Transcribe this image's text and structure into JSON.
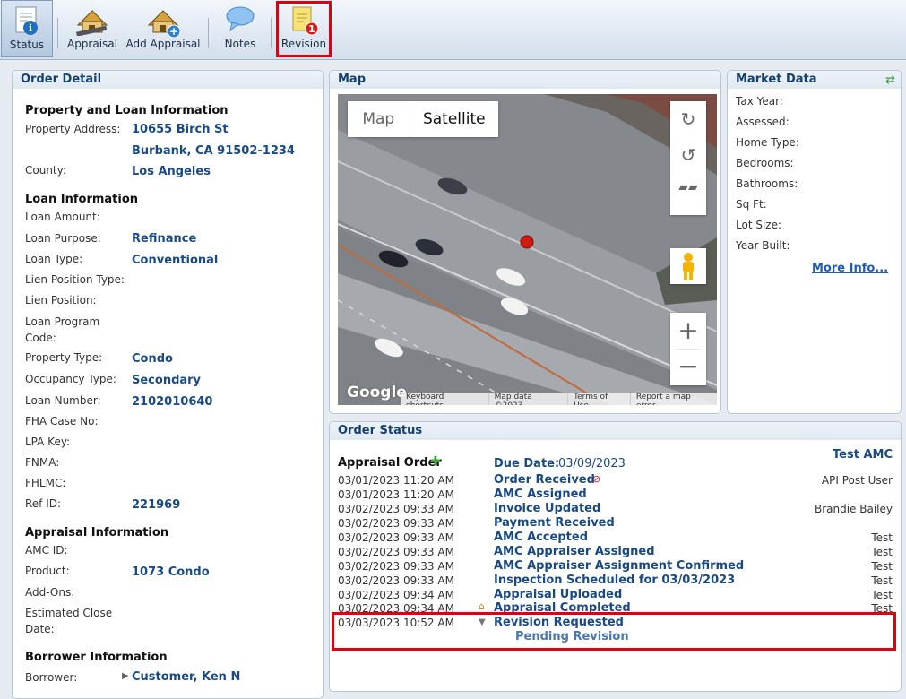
{
  "toolbar": {
    "items": [
      {
        "label": "Status"
      },
      {
        "label": "Appraisal"
      },
      {
        "label": "Add Appraisal"
      },
      {
        "label": "Notes"
      },
      {
        "label": "Revision",
        "badge": "1"
      }
    ]
  },
  "order_detail": {
    "title": "Order Detail",
    "sections": {
      "property": "Property and Loan Information",
      "loan": "Loan Information",
      "appraisal": "Appraisal Information",
      "borrower": "Borrower Information"
    },
    "fields": {
      "property_address_label": "Property Address:",
      "property_address_1": "10655 Birch St",
      "property_address_2": "Burbank, CA 91502-1234",
      "county_label": "County:",
      "county": "Los Angeles",
      "loan_amount_label": "Loan Amount:",
      "loan_purpose_label": "Loan Purpose:",
      "loan_purpose": "Refinance",
      "loan_type_label": "Loan Type:",
      "loan_type": "Conventional",
      "lien_position_type_label": "Lien Position Type:",
      "lien_position_label": "Lien Position:",
      "loan_program_label_1": "Loan Program",
      "loan_program_label_2": "Code:",
      "property_type_label": "Property Type:",
      "property_type": "Condo",
      "occupancy_type_label": "Occupancy Type:",
      "occupancy_type": "Secondary",
      "loan_number_label": "Loan Number:",
      "loan_number": "2102010640",
      "fha_label": "FHA Case No:",
      "lpa_label": "LPA Key:",
      "fnma_label": "FNMA:",
      "fhlmc_label": "FHLMC:",
      "ref_id_label": "Ref ID:",
      "ref_id": "221969",
      "amc_id_label": "AMC ID:",
      "product_label": "Product:",
      "product": "1073 Condo",
      "addons_label": "Add-Ons:",
      "est_close_label_1": "Estimated Close",
      "est_close_label_2": "Date:",
      "borrower_label": "Borrower:",
      "borrower": "Customer, Ken N"
    }
  },
  "map": {
    "title": "Map",
    "map_btn": "Map",
    "satellite_btn": "Satellite",
    "google": "Google",
    "footer": [
      "Keyboard shortcuts",
      "Map data ©2023",
      "Terms of Use",
      "Report a map error"
    ]
  },
  "market": {
    "title": "Market Data",
    "labels": [
      "Tax Year:",
      "Assessed:",
      "Home Type:",
      "Bedrooms:",
      "Bathrooms:",
      "Sq Ft:",
      "Lot Size:",
      "Year Built:"
    ],
    "more": "More Info..."
  },
  "order_status": {
    "title": "Order Status",
    "vendor": "Test AMC",
    "appraisal_order": "Appraisal Order",
    "due_label": "Due Date:",
    "due_date": "03/09/2023",
    "events": [
      {
        "dt": "03/01/2023 11:20 AM",
        "ev": "Order Received",
        "user": "API Post User"
      },
      {
        "dt": "03/01/2023 11:20 AM",
        "ev": "AMC Assigned",
        "user": ""
      },
      {
        "dt": "03/02/2023 09:33 AM",
        "ev": "Invoice Updated",
        "user": "Brandie Bailey"
      },
      {
        "dt": "03/02/2023 09:33 AM",
        "ev": "Payment Received",
        "user": ""
      },
      {
        "dt": "03/02/2023 09:33 AM",
        "ev": "AMC Accepted",
        "user": "Test"
      },
      {
        "dt": "03/02/2023 09:33 AM",
        "ev": "AMC Appraiser Assigned",
        "user": "Test"
      },
      {
        "dt": "03/02/2023 09:33 AM",
        "ev": "AMC Appraiser Assignment Confirmed",
        "user": "Test"
      },
      {
        "dt": "03/02/2023 09:33 AM",
        "ev": "Inspection Scheduled for 03/03/2023",
        "user": "Test"
      },
      {
        "dt": "03/02/2023 09:34 AM",
        "ev": "Appraisal Uploaded",
        "user": "Test"
      },
      {
        "dt": "03/02/2023 09:34 AM",
        "ev": "Appraisal Completed",
        "user": "Test"
      },
      {
        "dt": "03/03/2023 10:52 AM",
        "ev": "Revision Requested",
        "user": ""
      }
    ],
    "pending": "Pending Revision"
  }
}
